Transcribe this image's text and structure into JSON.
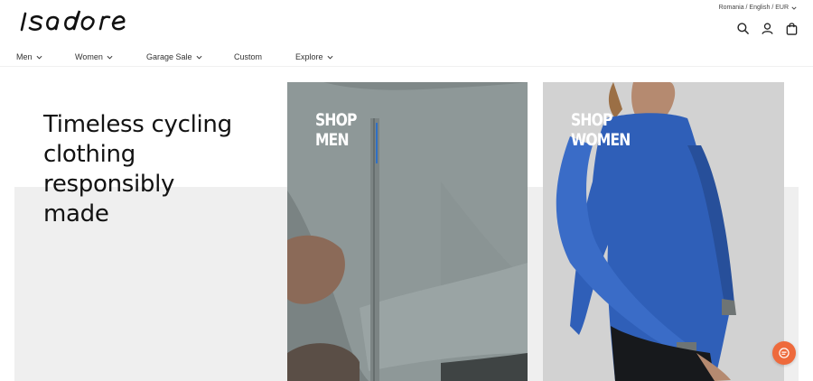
{
  "brand": {
    "logo_text": "Isadore"
  },
  "locale": {
    "label": "Romania / English / EUR"
  },
  "header_icons": [
    "search-icon",
    "account-icon",
    "cart-icon"
  ],
  "nav": {
    "items": [
      {
        "label": "Men",
        "has_dropdown": true
      },
      {
        "label": "Women",
        "has_dropdown": true
      },
      {
        "label": "Garage Sale",
        "has_dropdown": true
      },
      {
        "label": "Custom",
        "has_dropdown": false
      },
      {
        "label": "Explore",
        "has_dropdown": true
      }
    ]
  },
  "hero": {
    "title_lines": [
      "Timeless cycling",
      "clothing",
      "responsibly",
      "made"
    ],
    "panels": [
      {
        "line1": "SHOP",
        "line2": "MEN"
      },
      {
        "line1": "SHOP",
        "line2": "WOMEN"
      }
    ]
  },
  "colors": {
    "accent_chat": "#ee6a3c",
    "hero_bg": "#efefef",
    "men_jersey": "#8c9595",
    "women_jersey": "#2f5fb8"
  }
}
